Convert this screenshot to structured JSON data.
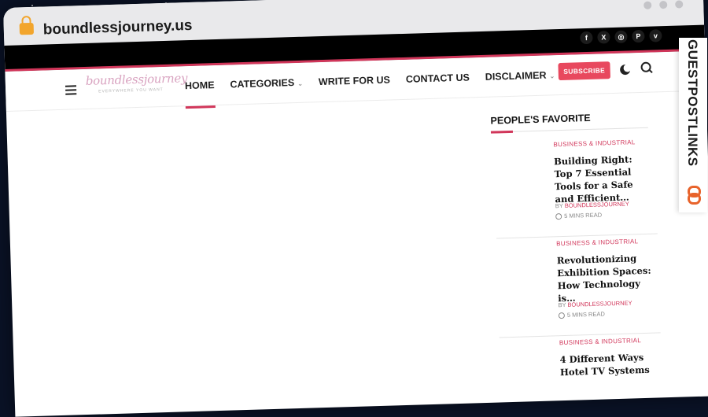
{
  "browser": {
    "url": "boundlessjourney.us"
  },
  "topbar": {
    "socials": [
      {
        "icon": "facebook-icon",
        "glyph": "f"
      },
      {
        "icon": "x-icon",
        "glyph": "X"
      },
      {
        "icon": "instagram-icon",
        "glyph": "◎"
      },
      {
        "icon": "pinterest-icon",
        "glyph": "P"
      },
      {
        "icon": "vimeo-icon",
        "glyph": "v"
      }
    ],
    "accent_color": "#d1365a"
  },
  "nav": {
    "logo_text": "boundlessjourney",
    "logo_tagline": "EVERYWHERE YOU WANT",
    "menu": [
      {
        "label": "HOME",
        "active": true,
        "dropdown": false
      },
      {
        "label": "CATEGORIES",
        "active": false,
        "dropdown": true
      },
      {
        "label": "WRITE FOR US",
        "active": false,
        "dropdown": false
      },
      {
        "label": "CONTACT US",
        "active": false,
        "dropdown": false
      },
      {
        "label": "DISCLAIMER",
        "active": false,
        "dropdown": true
      }
    ],
    "dropdown_glyph": "⌄",
    "subscribe_label": "SUBSCRIBE",
    "subscribe_color": "#e8485e"
  },
  "sidebar": {
    "title": "PEOPLE'S FAVORITE",
    "posts": [
      {
        "category": "BUSINESS & INDUSTRIAL",
        "title": "Building Right: Top 7 Essential Tools for a Safe and Efficient…",
        "author_prefix": "BY",
        "author": "BOUNDLESSJOURNEY",
        "read_time": "5 MINS READ"
      },
      {
        "category": "BUSINESS & INDUSTRIAL",
        "title": "Revolutionizing Exhibition Spaces: How Technology is…",
        "author_prefix": "BY",
        "author": "BOUNDLESSJOURNEY",
        "read_time": "5 MINS READ"
      },
      {
        "category": "BUSINESS & INDUSTRIAL",
        "title": "4 Different Ways Hotel TV Systems",
        "author_prefix": "",
        "author": "",
        "read_time": ""
      }
    ]
  },
  "watermark": {
    "text": "GUESTPOSTLINKS",
    "color": "#e8632b"
  }
}
